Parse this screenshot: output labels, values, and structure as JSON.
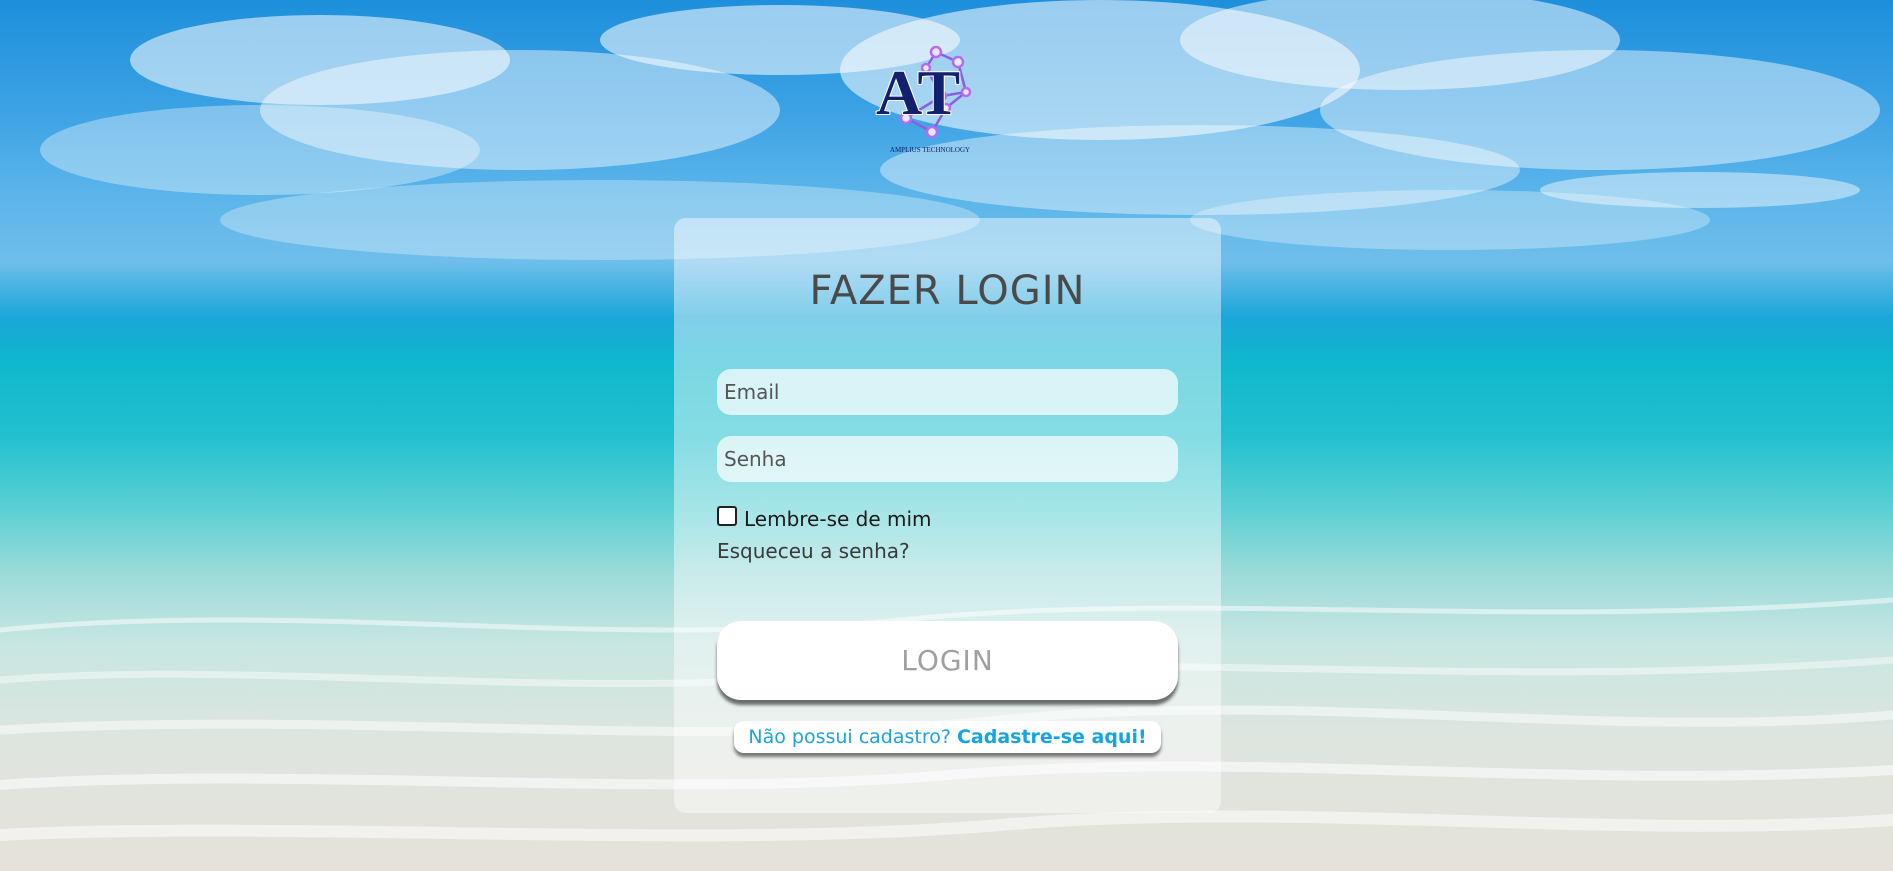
{
  "brand": {
    "logo_letters": "AT",
    "logo_tagline": "AMPLIUS TECHNOLOGY"
  },
  "login": {
    "title": "FAZER LOGIN",
    "email_placeholder": "Email",
    "password_placeholder": "Senha",
    "remember_label": "Lembre-se de mim",
    "remember_checked": false,
    "forgot_label": "Esqueceu a senha?",
    "submit_label": "LOGIN",
    "signup_prompt": "Não possui cadastro?",
    "signup_link": "Cadastre-se aqui!"
  },
  "colors": {
    "accent": "#1aa3e0",
    "logo_navy": "#12206e",
    "logo_nodes": "#b66cf0"
  }
}
